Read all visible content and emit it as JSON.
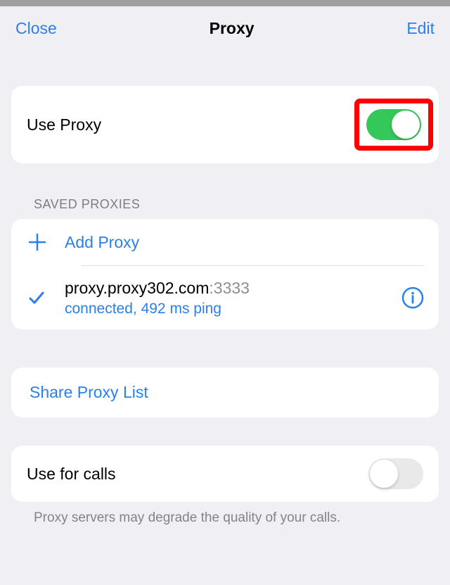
{
  "header": {
    "close_label": "Close",
    "title": "Proxy",
    "edit_label": "Edit"
  },
  "use_proxy": {
    "label": "Use Proxy"
  },
  "saved_section": {
    "header": "SAVED PROXIES",
    "add_label": "Add Proxy",
    "proxy": {
      "host": "proxy.proxy302.com",
      "port": ":3333",
      "status": "connected, 492 ms ping"
    }
  },
  "share": {
    "label": "Share Proxy List"
  },
  "calls": {
    "label": "Use for calls",
    "footer": "Proxy servers may degrade the quality of your calls."
  }
}
